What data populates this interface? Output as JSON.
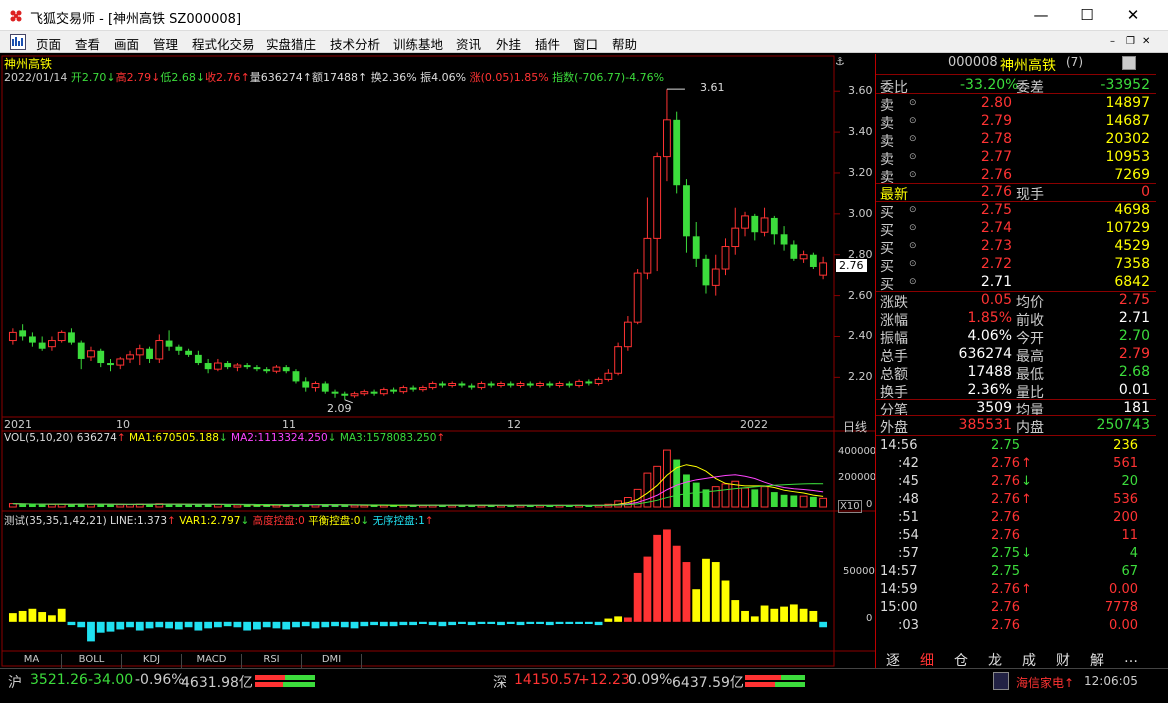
{
  "window": {
    "title": "飞狐交易师 - [神州高铁 SZ000008]",
    "min": "—",
    "max": "☐",
    "close": "✕"
  },
  "menu": [
    "页面",
    "查看",
    "画面",
    "管理",
    "程式化交易",
    "实盘猎庄",
    "技术分析",
    "训练基地",
    "资讯",
    "外挂",
    "插件",
    "窗口",
    "帮助"
  ],
  "mdi": {
    "min": "–",
    "restore": "❐",
    "close": "✕"
  },
  "chart": {
    "name": "神州高铁",
    "info": {
      "date": "2022/01/14",
      "open": "开2.70",
      "open_arrow": "↓",
      "high": "高2.79",
      "high_arrow": "↓",
      "low": "低2.68",
      "low_arrow": "↓",
      "close": "收2.76",
      "close_arrow": "↑",
      "vol": "量636274",
      "vol_arrow": "↑",
      "amt": "额17488",
      "amt_arrow": "↑",
      "turn": "换2.36%",
      "amp": "振4.06%",
      "chg": "涨(0.05)1.85%",
      "idx": "指数(-706.77)-4.76%"
    },
    "price_ticks": [
      "3.60",
      "3.40",
      "3.20",
      "3.00",
      "2.80",
      "2.60",
      "2.40",
      "2.20"
    ],
    "cur_price": "2.76",
    "max_label": "3.61",
    "min_label": "2.09",
    "months": [
      "2021",
      "10",
      "11",
      "12",
      "2022"
    ],
    "period": "日线",
    "vol_header": {
      "a": "VOL(5,10,20) 636274",
      "a_arrow": "↑",
      "b": "MA1:670505.188",
      "b_arrow": "↓",
      "c": "MA2:1113324.250",
      "c_arrow": "↓",
      "d": "MA3:1578083.250",
      "d_arrow": "↑"
    },
    "vol_ticks": [
      "400000",
      "200000",
      "0"
    ],
    "vol_unit": "X10",
    "ind_header": {
      "a": "测试(35,35,1,42,21) LINE:1.373",
      "a_arrow": "↑",
      "b": "VAR1:2.797",
      "b_arrow": "↓",
      "c": "高度控盘:0",
      "d": "平衡控盘:0",
      "d_arrow": "↓",
      "e": "无序控盘:1",
      "e_arrow": "↑"
    },
    "ind_ticks": [
      "50000",
      "0"
    ],
    "bottom_tabs": [
      "MA",
      "BOLL",
      "KDJ",
      "MACD",
      "RSI",
      "DMI"
    ]
  },
  "chart_data": [
    {
      "type": "candlestick",
      "title": "神州高铁",
      "ylim": [
        2.05,
        3.65
      ],
      "candles": [
        [
          2.38,
          2.42,
          2.44,
          2.36
        ],
        [
          2.43,
          2.4,
          2.46,
          2.38
        ],
        [
          2.4,
          2.37,
          2.42,
          2.35
        ],
        [
          2.37,
          2.34,
          2.4,
          2.33
        ],
        [
          2.35,
          2.38,
          2.4,
          2.33
        ],
        [
          2.38,
          2.42,
          2.43,
          2.37
        ],
        [
          2.42,
          2.37,
          2.44,
          2.36
        ],
        [
          2.37,
          2.29,
          2.38,
          2.24
        ],
        [
          2.3,
          2.33,
          2.35,
          2.28
        ],
        [
          2.33,
          2.27,
          2.34,
          2.25
        ],
        [
          2.27,
          2.26,
          2.29,
          2.23
        ],
        [
          2.26,
          2.29,
          2.3,
          2.24
        ],
        [
          2.29,
          2.31,
          2.33,
          2.27
        ],
        [
          2.31,
          2.34,
          2.36,
          2.26
        ],
        [
          2.34,
          2.29,
          2.35,
          2.27
        ],
        [
          2.29,
          2.38,
          2.41,
          2.27
        ],
        [
          2.38,
          2.35,
          2.43,
          2.33
        ],
        [
          2.35,
          2.33,
          2.36,
          2.31
        ],
        [
          2.33,
          2.31,
          2.34,
          2.3
        ],
        [
          2.31,
          2.27,
          2.33,
          2.26
        ],
        [
          2.27,
          2.24,
          2.29,
          2.22
        ],
        [
          2.24,
          2.27,
          2.29,
          2.23
        ],
        [
          2.27,
          2.25,
          2.28,
          2.24
        ],
        [
          2.25,
          2.26,
          2.27,
          2.23
        ],
        [
          2.26,
          2.25,
          2.27,
          2.24
        ],
        [
          2.25,
          2.24,
          2.26,
          2.23
        ],
        [
          2.24,
          2.23,
          2.25,
          2.22
        ],
        [
          2.23,
          2.25,
          2.26,
          2.22
        ],
        [
          2.25,
          2.23,
          2.26,
          2.22
        ],
        [
          2.23,
          2.18,
          2.24,
          2.17
        ],
        [
          2.18,
          2.15,
          2.2,
          2.13
        ],
        [
          2.15,
          2.17,
          2.18,
          2.13
        ],
        [
          2.17,
          2.13,
          2.18,
          2.12
        ],
        [
          2.13,
          2.12,
          2.14,
          2.1
        ],
        [
          2.12,
          2.11,
          2.13,
          2.09
        ],
        [
          2.11,
          2.12,
          2.13,
          2.1
        ],
        [
          2.12,
          2.13,
          2.14,
          2.11
        ],
        [
          2.13,
          2.12,
          2.14,
          2.11
        ],
        [
          2.12,
          2.14,
          2.15,
          2.11
        ],
        [
          2.14,
          2.13,
          2.15,
          2.12
        ],
        [
          2.13,
          2.15,
          2.16,
          2.12
        ],
        [
          2.15,
          2.14,
          2.16,
          2.13
        ],
        [
          2.14,
          2.15,
          2.16,
          2.13
        ],
        [
          2.15,
          2.17,
          2.18,
          2.14
        ],
        [
          2.17,
          2.16,
          2.18,
          2.15
        ],
        [
          2.16,
          2.17,
          2.18,
          2.15
        ],
        [
          2.17,
          2.16,
          2.18,
          2.15
        ],
        [
          2.16,
          2.15,
          2.17,
          2.14
        ],
        [
          2.15,
          2.17,
          2.18,
          2.14
        ],
        [
          2.17,
          2.16,
          2.18,
          2.15
        ],
        [
          2.16,
          2.17,
          2.18,
          2.15
        ],
        [
          2.17,
          2.16,
          2.18,
          2.15
        ],
        [
          2.16,
          2.17,
          2.18,
          2.15
        ],
        [
          2.17,
          2.16,
          2.18,
          2.15
        ],
        [
          2.16,
          2.17,
          2.18,
          2.15
        ],
        [
          2.17,
          2.16,
          2.18,
          2.15
        ],
        [
          2.16,
          2.17,
          2.18,
          2.15
        ],
        [
          2.17,
          2.16,
          2.18,
          2.15
        ],
        [
          2.16,
          2.18,
          2.19,
          2.15
        ],
        [
          2.18,
          2.17,
          2.19,
          2.16
        ],
        [
          2.17,
          2.19,
          2.2,
          2.16
        ],
        [
          2.19,
          2.22,
          2.24,
          2.18
        ],
        [
          2.22,
          2.35,
          2.37,
          2.21
        ],
        [
          2.35,
          2.47,
          2.5,
          2.33
        ],
        [
          2.47,
          2.71,
          2.73,
          2.46
        ],
        [
          2.71,
          2.88,
          3.08,
          2.68
        ],
        [
          2.88,
          3.28,
          3.3,
          2.72
        ],
        [
          3.28,
          3.46,
          3.61,
          3.16
        ],
        [
          3.46,
          3.14,
          3.5,
          3.1
        ],
        [
          3.14,
          2.89,
          3.17,
          2.81
        ],
        [
          2.89,
          2.78,
          2.96,
          2.74
        ],
        [
          2.78,
          2.65,
          2.8,
          2.61
        ],
        [
          2.65,
          2.73,
          2.8,
          2.6
        ],
        [
          2.73,
          2.84,
          2.88,
          2.7
        ],
        [
          2.84,
          2.93,
          3.03,
          2.8
        ],
        [
          2.93,
          2.99,
          3.01,
          2.89
        ],
        [
          2.99,
          2.91,
          3.0,
          2.87
        ],
        [
          2.91,
          2.98,
          3.03,
          2.89
        ],
        [
          2.98,
          2.9,
          2.99,
          2.85
        ],
        [
          2.9,
          2.85,
          2.94,
          2.82
        ],
        [
          2.85,
          2.78,
          2.87,
          2.77
        ],
        [
          2.78,
          2.8,
          2.82,
          2.76
        ],
        [
          2.8,
          2.74,
          2.81,
          2.73
        ],
        [
          2.7,
          2.76,
          2.79,
          2.68
        ]
      ]
    },
    {
      "type": "bar",
      "title": "VOL(5,10,20)",
      "ylim": [
        0,
        450000
      ],
      "values": [
        25000,
        22000,
        20000,
        18000,
        19000,
        21000,
        20000,
        26000,
        20000,
        19000,
        18000,
        17000,
        18000,
        22000,
        20000,
        24000,
        21000,
        18000,
        17000,
        19000,
        22000,
        18000,
        16000,
        15000,
        14000,
        14000,
        13000,
        14000,
        13000,
        18000,
        22000,
        16000,
        17000,
        15000,
        14000,
        13000,
        12000,
        12000,
        13000,
        12000,
        13000,
        12000,
        12000,
        14000,
        13000,
        12000,
        12000,
        13000,
        12000,
        12000,
        12000,
        12000,
        12000,
        12000,
        12000,
        12000,
        12000,
        12000,
        13000,
        12000,
        13000,
        20000,
        45000,
        70000,
        130000,
        250000,
        300000,
        420000,
        350000,
        240000,
        180000,
        130000,
        150000,
        170000,
        190000,
        140000,
        130000,
        150000,
        110000,
        90000,
        85000,
        80000,
        75000,
        64000
      ]
    },
    {
      "type": "bar",
      "title": "测试(35,35,1,42,21)",
      "ylim": [
        -25000,
        90000
      ],
      "values": [
        8000,
        10000,
        12000,
        9000,
        6000,
        12000,
        -3000,
        -5000,
        -18000,
        -10000,
        -9000,
        -7000,
        -5000,
        -8000,
        -6000,
        -5000,
        -6000,
        -7000,
        -5000,
        -8000,
        -6000,
        -5000,
        -4000,
        -5000,
        -8000,
        -7000,
        -5000,
        -6000,
        -7000,
        -5000,
        -4000,
        -6000,
        -5000,
        -4000,
        -5000,
        -6000,
        -4000,
        -3000,
        -4000,
        -4000,
        -3000,
        -3000,
        -2000,
        -3000,
        -4000,
        -3000,
        -2000,
        -3000,
        -2000,
        -2000,
        -3000,
        -2000,
        -3000,
        -2000,
        -2000,
        -3000,
        -2000,
        -2000,
        -2000,
        -2000,
        -3000,
        3000,
        5000,
        4000,
        45000,
        60000,
        80000,
        85000,
        70000,
        55000,
        30000,
        58000,
        55000,
        38000,
        20000,
        10000,
        5000,
        15000,
        12000,
        14000,
        16000,
        12000,
        10000,
        -5000
      ]
    }
  ],
  "quote": {
    "code": "000008",
    "name": "神州高铁",
    "seq": "(7)",
    "weibi": {
      "l": "委比",
      "v": "-33.20%",
      "l2": "委差",
      "v2": "-33952"
    },
    "sell": [
      {
        "l": "卖",
        "p": "2.80",
        "v": "14897"
      },
      {
        "l": "卖",
        "p": "2.79",
        "v": "14687"
      },
      {
        "l": "卖",
        "p": "2.78",
        "v": "20302"
      },
      {
        "l": "卖",
        "p": "2.77",
        "v": "10953"
      },
      {
        "l": "卖",
        "p": "2.76",
        "v": "7269"
      }
    ],
    "latest": {
      "l": "最新",
      "p": "2.76",
      "l2": "现手",
      "v": "0"
    },
    "buy": [
      {
        "l": "买",
        "p": "2.75",
        "v": "4698"
      },
      {
        "l": "买",
        "p": "2.74",
        "v": "10729"
      },
      {
        "l": "买",
        "p": "2.73",
        "v": "4529"
      },
      {
        "l": "买",
        "p": "2.72",
        "v": "7358"
      },
      {
        "l": "买",
        "p": "2.71",
        "v": "6842"
      }
    ],
    "stats": [
      {
        "l": "涨跌",
        "v": "0.05",
        "l2": "均价",
        "v2": "2.75",
        "c1": "#ff3333",
        "c2": "#ff3333"
      },
      {
        "l": "涨幅",
        "v": "1.85%",
        "l2": "前收",
        "v2": "2.71",
        "c1": "#ff3333",
        "c2": "#ffffff"
      },
      {
        "l": "振幅",
        "v": "4.06%",
        "l2": "今开",
        "v2": "2.70",
        "c1": "#ffffff",
        "c2": "#3cdc3c"
      },
      {
        "l": "总手",
        "v": "636274",
        "l2": "最高",
        "v2": "2.79",
        "c1": "#ffffff",
        "c2": "#ff3333"
      },
      {
        "l": "总额",
        "v": "17488",
        "l2": "最低",
        "v2": "2.68",
        "c1": "#ffffff",
        "c2": "#3cdc3c"
      },
      {
        "l": "换手",
        "v": "2.36%",
        "l2": "量比",
        "v2": "0.01",
        "c1": "#ffffff",
        "c2": "#ffffff"
      },
      {
        "l": "分笔",
        "v": "3509",
        "l2": "均量",
        "v2": "181",
        "c1": "#ffffff",
        "c2": "#ffffff"
      }
    ],
    "outer": {
      "l": "外盘",
      "v": "385531",
      "l2": "内盘",
      "v2": "250743"
    },
    "ticks": [
      {
        "t": "14:56",
        "p": "2.75",
        "v": "236",
        "a": "",
        "pc": "#3cdc3c",
        "vc": "#ffff00"
      },
      {
        "t": ":42",
        "p": "2.76",
        "v": "561",
        "a": "↑",
        "pc": "#ff3333",
        "vc": "#ff3333"
      },
      {
        "t": ":45",
        "p": "2.76",
        "v": "20",
        "a": "↓",
        "pc": "#ff3333",
        "vc": "#3cdc3c"
      },
      {
        "t": ":48",
        "p": "2.76",
        "v": "536",
        "a": "↑",
        "pc": "#ff3333",
        "vc": "#ff3333"
      },
      {
        "t": ":51",
        "p": "2.76",
        "v": "200",
        "a": "",
        "pc": "#ff3333",
        "vc": "#ff3333"
      },
      {
        "t": ":54",
        "p": "2.76",
        "v": "11",
        "a": "",
        "pc": "#ff3333",
        "vc": "#ff3333"
      },
      {
        "t": ":57",
        "p": "2.75",
        "v": "4",
        "a": "↓",
        "pc": "#3cdc3c",
        "vc": "#3cdc3c"
      },
      {
        "t": "14:57",
        "p": "2.75",
        "v": "67",
        "a": "",
        "pc": "#3cdc3c",
        "vc": "#3cdc3c"
      },
      {
        "t": "14:59",
        "p": "2.76",
        "v": "0.00",
        "a": "↑",
        "pc": "#ff3333",
        "vc": "#ff3333"
      },
      {
        "t": "15:00",
        "p": "2.76",
        "v": "7778",
        "a": "",
        "pc": "#ff3333",
        "vc": "#ff3333"
      },
      {
        "t": ":03",
        "p": "2.76",
        "v": "0.00",
        "a": "",
        "pc": "#ff3333",
        "vc": "#ff3333"
      }
    ],
    "tabs": [
      "逐",
      "细",
      "仓",
      "龙",
      "成",
      "财",
      "解",
      "…"
    ]
  },
  "status": {
    "sh": "沪",
    "sh_idx": "3521.26",
    "sh_chg": "-34.00",
    "sh_pct": "-0.96%",
    "sh_amt": "4631.98亿",
    "sz": "深",
    "sz_idx": "14150.57",
    "sz_chg": "+12.23",
    "sz_pct": "0.09%",
    "sz_amt": "6437.59亿",
    "news": "海信家电↑",
    "time": "12:06:05"
  },
  "colors": {
    "up": "#ff3333",
    "down": "#3cdc3c",
    "cyan": "#20e0f0",
    "yellow": "#ffff00",
    "grid": "#8b0000",
    "text": "#c0c0c0"
  }
}
